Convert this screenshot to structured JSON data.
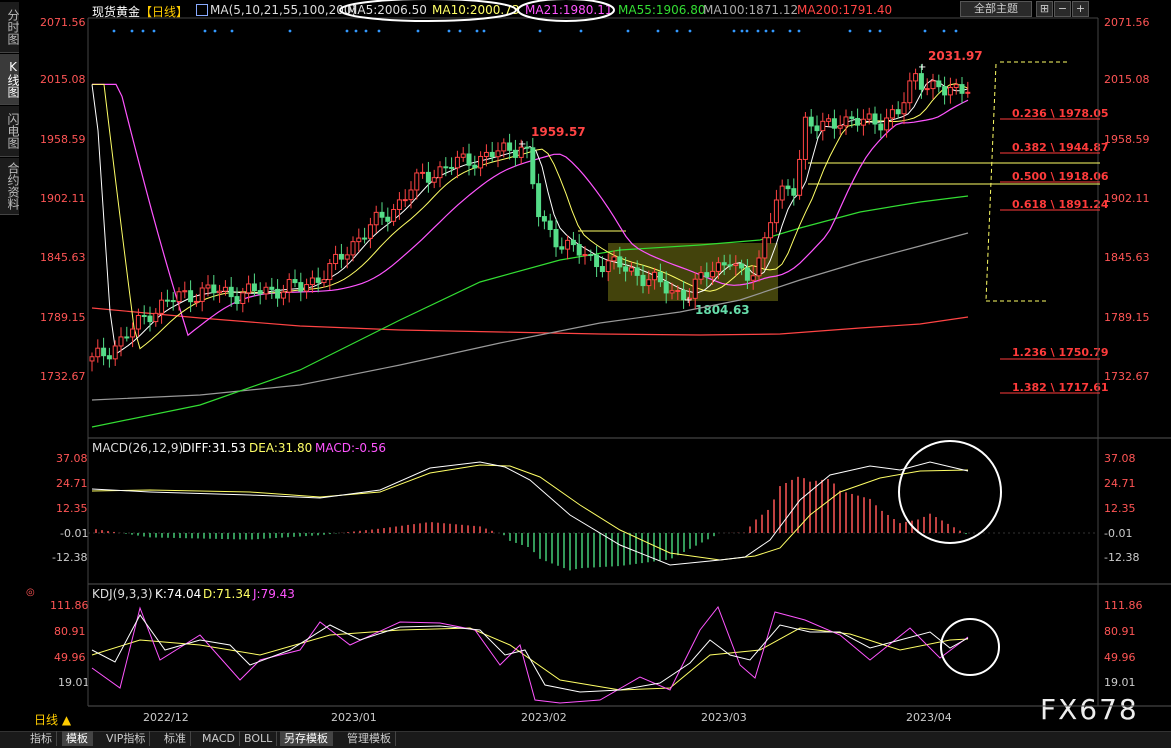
{
  "left_tabs": [
    "分时图",
    "K线图",
    "闪电图",
    "合约资料"
  ],
  "header": {
    "symbol": "现货黄金",
    "period": "【日线】",
    "ma_prefix": "MA(5,10,21,55,100,200)",
    "ma": [
      {
        "label": "MA5:2006.50",
        "color": "#dddddd"
      },
      {
        "label": "MA10:2000.73",
        "color": "#ffff66"
      },
      {
        "label": "MA21:1980.11",
        "color": "#ff55ff"
      },
      {
        "label": "MA55:1906.80",
        "color": "#33dd33"
      },
      {
        "label": "MA100:1871.12",
        "color": "#aaaaaa"
      },
      {
        "label": "MA200:1791.40",
        "color": "#ff4444"
      }
    ],
    "theme_button": "全部主题"
  },
  "price_axis": [
    "2071.56",
    "2015.08",
    "1958.59",
    "1902.11",
    "1845.63",
    "1789.15",
    "1732.67"
  ],
  "annotations": {
    "high1": "1959.57",
    "low1": "1804.63",
    "high2": "2031.97"
  },
  "fib_levels": [
    "0.236 \\ 1978.05",
    "0.382 \\ 1944.87",
    "0.500 \\ 1918.06",
    "0.618 \\ 1891.24",
    "1.236 \\ 1750.79",
    "1.382 \\ 1717.61"
  ],
  "macd": {
    "title": "MACD(26,12,9)",
    "diff": "DIFF:31.53",
    "dea": "DEA:31.80",
    "macd": "MACD:-0.56",
    "axis": [
      "37.08",
      "24.71",
      "12.35",
      "-0.01",
      "-12.38"
    ]
  },
  "kdj": {
    "title": "KDJ(9,3,3)",
    "k": "K:74.04",
    "d": "D:71.34",
    "j": "J:79.43",
    "axis": [
      "111.86",
      "80.91",
      "49.96",
      "19.01"
    ]
  },
  "dates": [
    "2022/12",
    "2023/01",
    "2023/02",
    "2023/03",
    "2023/04"
  ],
  "period_selector": "日线 ▲",
  "watermark": "FX678",
  "bottom_tabs": [
    "指标",
    "模板",
    "VIP指标",
    "标准",
    "MACD",
    "BOLL",
    "另存模板",
    "管理模板"
  ],
  "chart_data": [
    {
      "type": "candlestick",
      "title": "现货黄金 日线",
      "ylim": [
        1715,
        2075
      ],
      "series": [
        {
          "name": "MA5",
          "value": 2006.5
        },
        {
          "name": "MA10",
          "value": 2000.73
        },
        {
          "name": "MA21",
          "value": 1980.11
        },
        {
          "name": "MA55",
          "value": 1906.8
        },
        {
          "name": "MA100",
          "value": 1871.12
        },
        {
          "name": "MA200",
          "value": 1791.4
        }
      ],
      "annotations": [
        "1959.57",
        "1804.63",
        "2031.97"
      ]
    },
    {
      "type": "line",
      "title": "MACD(26,12,9)",
      "ylim": [
        -20,
        40
      ],
      "series": [
        {
          "name": "DIFF",
          "last": 31.53
        },
        {
          "name": "DEA",
          "last": 31.8
        },
        {
          "name": "MACD",
          "last": -0.56
        }
      ]
    },
    {
      "type": "line",
      "title": "KDJ(9,3,3)",
      "ylim": [
        0,
        120
      ],
      "series": [
        {
          "name": "K",
          "last": 74.04
        },
        {
          "name": "D",
          "last": 71.34
        },
        {
          "name": "J",
          "last": 79.43
        }
      ]
    }
  ]
}
